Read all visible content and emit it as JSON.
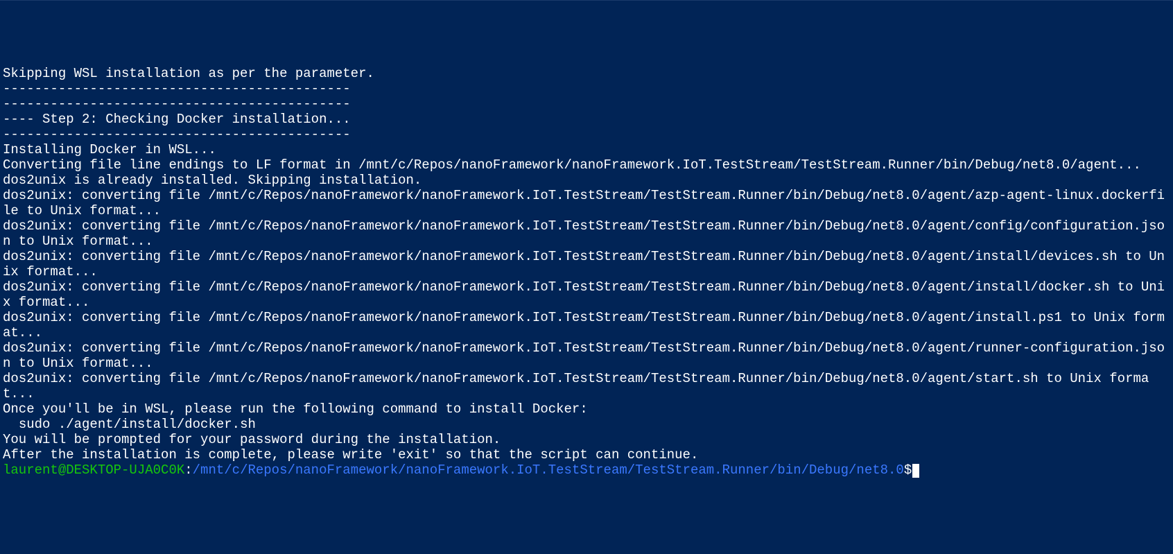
{
  "terminal": {
    "lines": [
      "Skipping WSL installation as per the parameter.",
      "--------------------------------------------",
      "",
      "--------------------------------------------",
      "---- Step 2: Checking Docker installation...",
      "--------------------------------------------",
      "Installing Docker in WSL...",
      "Converting file line endings to LF format in /mnt/c/Repos/nanoFramework/nanoFramework.IoT.TestStream/TestStream.Runner/bin/Debug/net8.0/agent...",
      "dos2unix is already installed. Skipping installation.",
      "dos2unix: converting file /mnt/c/Repos/nanoFramework/nanoFramework.IoT.TestStream/TestStream.Runner/bin/Debug/net8.0/agent/azp-agent-linux.dockerfile to Unix format...",
      "dos2unix: converting file /mnt/c/Repos/nanoFramework/nanoFramework.IoT.TestStream/TestStream.Runner/bin/Debug/net8.0/agent/config/configuration.json to Unix format...",
      "dos2unix: converting file /mnt/c/Repos/nanoFramework/nanoFramework.IoT.TestStream/TestStream.Runner/bin/Debug/net8.0/agent/install/devices.sh to Unix format...",
      "dos2unix: converting file /mnt/c/Repos/nanoFramework/nanoFramework.IoT.TestStream/TestStream.Runner/bin/Debug/net8.0/agent/install/docker.sh to Unix format...",
      "dos2unix: converting file /mnt/c/Repos/nanoFramework/nanoFramework.IoT.TestStream/TestStream.Runner/bin/Debug/net8.0/agent/install.ps1 to Unix format...",
      "dos2unix: converting file /mnt/c/Repos/nanoFramework/nanoFramework.IoT.TestStream/TestStream.Runner/bin/Debug/net8.0/agent/runner-configuration.json to Unix format...",
      "dos2unix: converting file /mnt/c/Repos/nanoFramework/nanoFramework.IoT.TestStream/TestStream.Runner/bin/Debug/net8.0/agent/start.sh to Unix format...",
      "Once you'll be in WSL, please run the following command to install Docker:",
      "  sudo ./agent/install/docker.sh",
      "You will be prompted for your password during the installation.",
      "After the installation is complete, please write 'exit' so that the script can continue."
    ],
    "prompt": {
      "user": "laurent@DESKTOP-UJA0C0K",
      "separator": ":",
      "path": "/mnt/c/Repos/nanoFramework/nanoFramework.IoT.TestStream/TestStream.Runner/bin/Debug/net8.0",
      "symbol": "$"
    }
  }
}
